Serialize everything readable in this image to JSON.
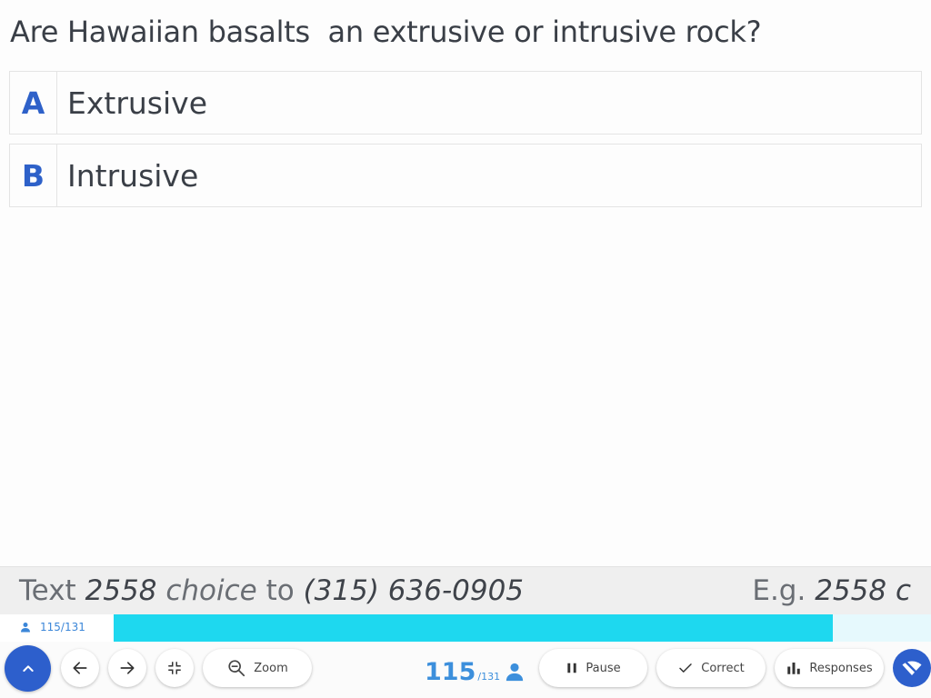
{
  "question": {
    "text": "Are Hawaiian basalts  an extrusive or intrusive rock?"
  },
  "choices": [
    {
      "letter": "A",
      "label": "Extrusive"
    },
    {
      "letter": "B",
      "label": "Intrusive"
    }
  ],
  "instructions": {
    "text_word": "Text",
    "code": "2558",
    "choice_word": "choice",
    "to_word": "to",
    "phone": "(315) 636-0905",
    "example_prefix": "E.g.",
    "example_value": "2558 c"
  },
  "progress": {
    "count_label": "115/131",
    "fraction": 0.88
  },
  "toolbar": {
    "zoom_label": "Zoom",
    "counter_value": "115",
    "counter_total": "/131",
    "pause_label": "Pause",
    "correct_label": "Correct",
    "responses_label": "Responses"
  },
  "colors": {
    "accent": "#2d5fcc",
    "progress_fill": "#1ed8ef",
    "counter": "#3c8fdc"
  },
  "icons": [
    "chevron-up-icon",
    "arrow-left-icon",
    "arrow-right-icon",
    "compress-icon",
    "zoom-out-icon",
    "user-icon",
    "pause-icon",
    "check-icon",
    "bar-chart-icon",
    "wifi-off-icon"
  ]
}
